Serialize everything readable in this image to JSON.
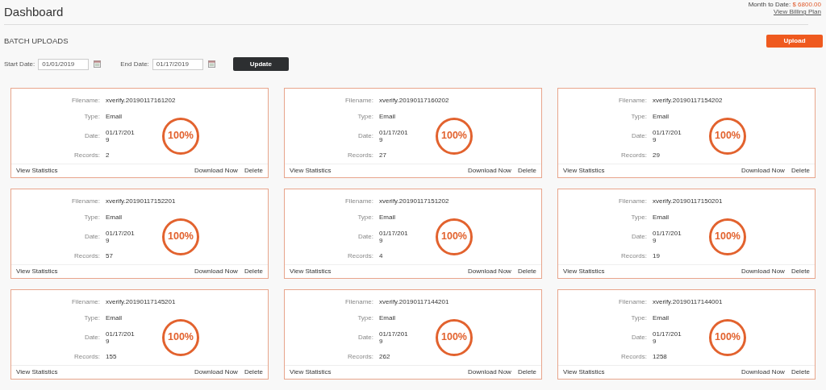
{
  "header": {
    "title": "Dashboard",
    "billing": {
      "label": "Month to Date:",
      "amount": "$ 6800.00",
      "link": "View Billing Plan"
    }
  },
  "section": {
    "title": "BATCH UPLOADS",
    "upload_button": "Upload"
  },
  "filters": {
    "start_label": "Start Date:",
    "start_value": "01/01/2019",
    "end_label": "End Date:",
    "end_value": "01/17/2019",
    "update_button": "Update"
  },
  "uploads": [
    {
      "labels": [
        "Filename:",
        "Type:",
        "Date:",
        "Records:"
      ],
      "filename": "xverify.20190117161202",
      "type": "Email",
      "date": "01/17/2019",
      "records": "2",
      "percent": "100%",
      "actions": [
        "View Statistics",
        "Download Now",
        "Delete"
      ]
    },
    {
      "labels": [
        "Filename:",
        "Type:",
        "Date:",
        "Records:"
      ],
      "filename": "xverify.20190117160202",
      "type": "Email",
      "date": "01/17/2019",
      "records": "27",
      "percent": "100%",
      "actions": [
        "View Statistics",
        "Download Now",
        "Delete"
      ]
    },
    {
      "labels": [
        "Filename:",
        "Type:",
        "Date:",
        "Records:"
      ],
      "filename": "xverify.20190117154202",
      "type": "Email",
      "date": "01/17/2019",
      "records": "29",
      "percent": "100%",
      "actions": [
        "View Statistics",
        "Download Now",
        "Delete"
      ]
    },
    {
      "labels": [
        "Filename:",
        "Type:",
        "Date:",
        "Records:"
      ],
      "filename": "xverify.20190117152201",
      "type": "Email",
      "date": "01/17/2019",
      "records": "57",
      "percent": "100%",
      "actions": [
        "View Statistics",
        "Download Now",
        "Delete"
      ]
    },
    {
      "labels": [
        "Filename:",
        "Type:",
        "Date:",
        "Records:"
      ],
      "filename": "xverify.20190117151202",
      "type": "Email",
      "date": "01/17/2019",
      "records": "4",
      "percent": "100%",
      "actions": [
        "View Statistics",
        "Download Now",
        "Delete"
      ]
    },
    {
      "labels": [
        "Filename:",
        "Type:",
        "Date:",
        "Records:"
      ],
      "filename": "xverify.20190117150201",
      "type": "Email",
      "date": "01/17/2019",
      "records": "19",
      "percent": "100%",
      "actions": [
        "View Statistics",
        "Download Now",
        "Delete"
      ]
    },
    {
      "labels": [
        "Filename:",
        "Type:",
        "Date:",
        "Records:"
      ],
      "filename": "xverify.20190117145201",
      "type": "Email",
      "date": "01/17/2019",
      "records": "155",
      "percent": "100%",
      "actions": [
        "View Statistics",
        "Download Now",
        "Delete"
      ]
    },
    {
      "labels": [
        "Filename:",
        "Type:",
        "Date:",
        "Records:"
      ],
      "filename": "xverify.20190117144201",
      "type": "Email",
      "date": "01/17/2019",
      "records": "262",
      "percent": "100%",
      "actions": [
        "View Statistics",
        "Download Now",
        "Delete"
      ]
    },
    {
      "labels": [
        "Filename:",
        "Type:",
        "Date:",
        "Records:"
      ],
      "filename": "xverify.20190117144001",
      "type": "Email",
      "date": "01/17/2019",
      "records": "1258",
      "percent": "100%",
      "actions": [
        "View Statistics",
        "Download Now",
        "Delete"
      ]
    }
  ]
}
